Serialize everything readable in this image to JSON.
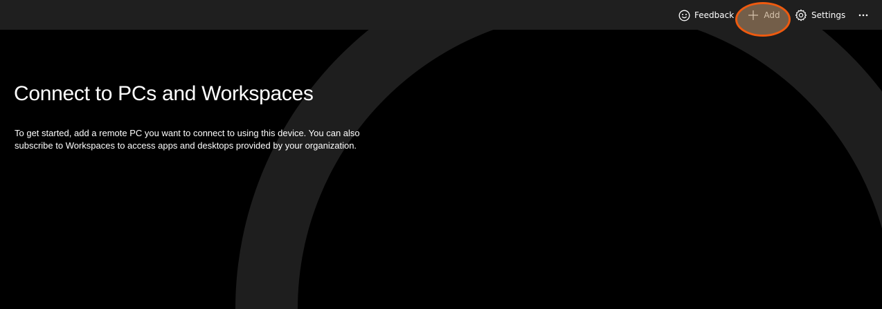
{
  "toolbar": {
    "feedback_label": "Feedback",
    "add_label": "Add",
    "settings_label": "Settings",
    "more_icon": "more-horizontal-icon",
    "highlight_color": "#ee5a0f"
  },
  "main": {
    "title": "Connect to PCs and Workspaces",
    "description": "To get started, add a remote PC you want to connect to using this device. You can also subscribe to Workspaces to access apps and desktops provided by your organization."
  },
  "colors": {
    "background": "#000000",
    "toolbar_background": "#1f1f1f",
    "arc": "#1e1e1e",
    "text": "#ffffff"
  }
}
